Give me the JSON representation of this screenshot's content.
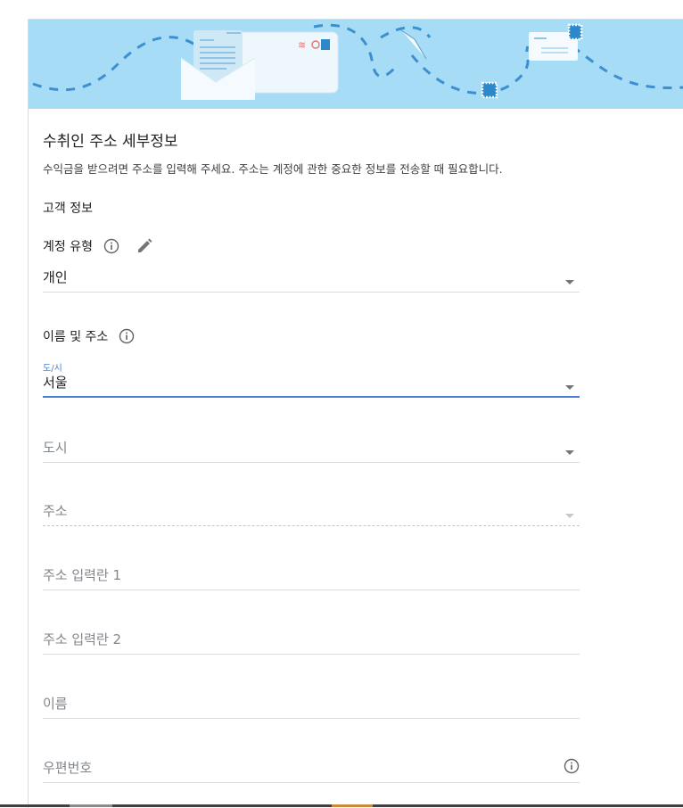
{
  "header": {
    "title": "수취인 주소 세부정보",
    "subtitle": "수익금을 받으려면 주소를 입력해 주세요. 주소는 계정에 관한 중요한 정보를 전송할 때 필요합니다."
  },
  "customer_info": {
    "heading": "고객 정보"
  },
  "account_type": {
    "label": "계정 유형",
    "value": "개인"
  },
  "name_address": {
    "label": "이름 및 주소"
  },
  "fields": {
    "province": {
      "float_label": "도/시",
      "value": "서울"
    },
    "city": {
      "placeholder": "도시"
    },
    "address": {
      "placeholder": "주소"
    },
    "address_line1": {
      "placeholder": "주소 입력란 1"
    },
    "address_line2": {
      "placeholder": "주소 입력란 2"
    },
    "name": {
      "placeholder": "이름"
    },
    "postal_code": {
      "placeholder": "우편번호"
    }
  },
  "colors": {
    "banner_bg": "#a6dcf5",
    "accent": "#4a7fd4"
  },
  "icons": [
    "info-icon",
    "edit-icon",
    "dropdown-arrow-icon",
    "envelope-illustration"
  ]
}
